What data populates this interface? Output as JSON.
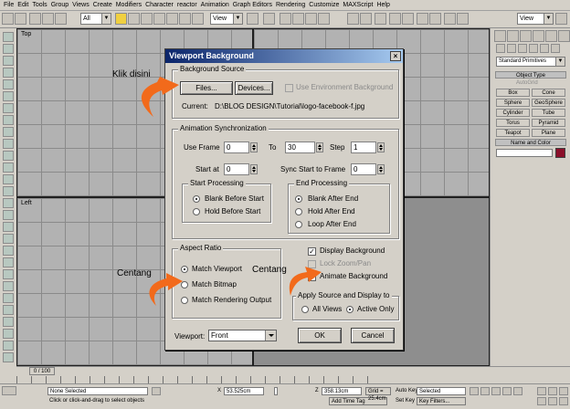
{
  "menu": [
    "File",
    "Edit",
    "Tools",
    "Group",
    "Views",
    "Create",
    "Modifiers",
    "Character",
    "reactor",
    "Animation",
    "Graph Editors",
    "Rendering",
    "Customize",
    "MAXScript",
    "Help"
  ],
  "toolbar": {
    "selection_filter": "All",
    "view_combo": "View",
    "view_combo_right": "View"
  },
  "command_panel": {
    "dropdown": "Standard Primitives",
    "object_type_title": "Object Type",
    "autogrid": "AutoGrid",
    "buttons": [
      "Box",
      "Cone",
      "Sphere",
      "GeoSphere",
      "Cylinder",
      "Tube",
      "Torus",
      "Pyramid",
      "Teapot",
      "Plane"
    ],
    "name_color_title": "Name and Color",
    "accent": "#8b0f2a"
  },
  "viewports": {
    "top": "Top",
    "left": "Left"
  },
  "dialog": {
    "title": "Viewport Background",
    "close": "×",
    "bg_source": {
      "title": "Background Source",
      "files_btn": "Files...",
      "devices_btn": "Devices...",
      "use_env": "Use Environment Background",
      "current_label": "Current:",
      "current_path": "D:\\BLOG DESIGN\\Tutorial\\logo-facebook-f.jpg"
    },
    "anim_sync": {
      "title": "Animation Synchronization",
      "use_frame_label": "Use Frame",
      "use_frame_value": "0",
      "to_label": "To",
      "to_value": "30",
      "step_label": "Step",
      "step_value": "1",
      "start_at_label": "Start at",
      "start_at_value": "0",
      "sync_start_label": "Sync Start to Frame",
      "sync_start_value": "0",
      "start_processing": {
        "title": "Start Processing",
        "opt1": "Blank Before Start",
        "opt2": "Hold Before Start"
      },
      "end_processing": {
        "title": "End Processing",
        "opt1": "Blank After End",
        "opt2": "Hold After End",
        "opt3": "Loop After End"
      }
    },
    "aspect": {
      "title": "Aspect Ratio",
      "opt1": "Match Viewport",
      "opt2": "Match Bitmap",
      "opt3": "Match Rendering Output"
    },
    "display_bg": "Display Background",
    "lock_zoom": "Lock Zoom/Pan",
    "animate_bg": "Animate Background",
    "apply": {
      "title": "Apply Source and Display to",
      "opt1": "All Views",
      "opt2": "Active Only"
    },
    "viewport_label": "Viewport:",
    "viewport_value": "Front",
    "ok": "OK",
    "cancel": "Cancel"
  },
  "annotations": {
    "klik": "Klik disini",
    "centang1": "Centang",
    "centang2": "Centang",
    "arrow_color": "#f26a1b"
  },
  "timeline": {
    "frame": "0 / 100"
  },
  "status": {
    "selection": "None Selected",
    "prompt": "Click or click-and-drag to select objects",
    "x_label": "X",
    "x_value": "53.525cm",
    "z_label": "Z",
    "z_value": "358.13cm",
    "grid": "Grid = 25.4cm",
    "add_time_tag": "Add Time Tag",
    "auto_key": "Auto Key",
    "selected": "Selected",
    "set_key": "Set Key",
    "key_filters": "Key Filters..."
  }
}
